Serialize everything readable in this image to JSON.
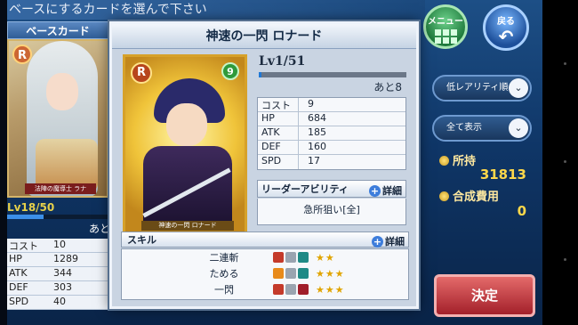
{
  "instruction": "ベースにするカードを選んで下さい",
  "base": {
    "header": "ベースカード",
    "rank": "R",
    "card_caption": "法陣の魔導士 ラナ",
    "level": "Lv18/50",
    "level_progress": 0.36,
    "remain": "あと8",
    "stats": [
      {
        "label": "コスト",
        "value": "10"
      },
      {
        "label": "HP",
        "value": "1289"
      },
      {
        "label": "ATK",
        "value": "344"
      },
      {
        "label": "DEF",
        "value": "303"
      },
      {
        "label": "SPD",
        "value": "40"
      }
    ]
  },
  "nav": {
    "menu_label": "メニュー",
    "back_label": "戻る",
    "back_icon": "↶"
  },
  "filters": {
    "sort_label": "低レアリティ順",
    "view_label": "全て表示",
    "chevron": "⌄"
  },
  "currency": {
    "owned_label": "所持",
    "owned_value": "31813",
    "cost_label": "合成費用",
    "cost_value": "0"
  },
  "decide_label": "決定",
  "modal": {
    "title": "神速の一閃 ロナード",
    "rank": "R",
    "cost_badge": "9",
    "card_caption": "神速の一閃 ロナード",
    "level": "Lv1/51",
    "level_progress": 0.02,
    "remain": "あと8",
    "stats": [
      {
        "label": "コスト",
        "value": "9"
      },
      {
        "label": "HP",
        "value": "684"
      },
      {
        "label": "ATK",
        "value": "185"
      },
      {
        "label": "DEF",
        "value": "160"
      },
      {
        "label": "SPD",
        "value": "17"
      }
    ],
    "leader": {
      "header": "リーダーアビリティ",
      "detail_label": "詳細",
      "text": "急所狙い[全]"
    },
    "skills": {
      "header": "スキル",
      "detail_label": "詳細",
      "items": [
        {
          "name": "二連斬",
          "stars": "★★",
          "rating": 2,
          "icons": [
            "sword-icon",
            "gray-icon",
            "teal-icon"
          ]
        },
        {
          "name": "ためる",
          "stars": "★★★",
          "rating": 3,
          "icons": [
            "fire-icon",
            "gray-icon",
            "teal-icon"
          ]
        },
        {
          "name": "一閃",
          "stars": "★★★",
          "rating": 3,
          "icons": [
            "sword-icon",
            "gray-icon",
            "red-icon"
          ]
        }
      ]
    }
  },
  "colors": {
    "accent_blue": "#1f78d6",
    "gold": "#ffd84a",
    "decide_red": "#a3202a"
  }
}
